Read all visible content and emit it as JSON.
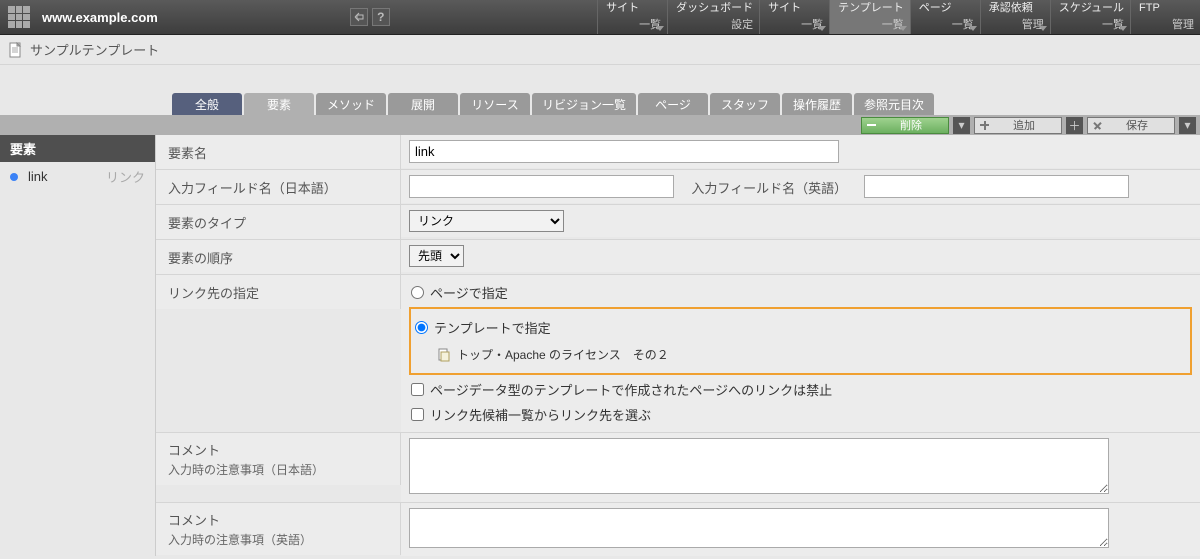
{
  "header": {
    "domain": "www.example.com"
  },
  "nav": {
    "site_list": {
      "title": "サイト",
      "sub": "一覧"
    },
    "dashboard": {
      "title": "ダッシュボード",
      "sub": "設定"
    },
    "site_admin": {
      "title": "サイト",
      "sub": "一覧"
    },
    "template": {
      "title": "テンプレート",
      "sub": "一覧"
    },
    "page": {
      "title": "ページ",
      "sub": "一覧"
    },
    "approval": {
      "title": "承認依頼",
      "sub": "管理"
    },
    "schedule": {
      "title": "スケジュール",
      "sub": "一覧"
    },
    "ftp": {
      "title": "FTP",
      "sub": "管理"
    }
  },
  "breadcrumb": {
    "title": "サンプルテンプレート"
  },
  "tabs": {
    "general": "全般",
    "element": "要素",
    "method": "メソッド",
    "expand": "展開",
    "resource": "リソース",
    "revision": "リビジョン一覧",
    "page": "ページ",
    "staff": "スタッフ",
    "history": "操作履歴",
    "ref_toc": "参照元目次"
  },
  "actions": {
    "delete": "削除",
    "add": "追加",
    "save": "保存"
  },
  "sidebar": {
    "title": "要素",
    "items": [
      {
        "name": "link",
        "type": "リンク"
      }
    ]
  },
  "form": {
    "labels": {
      "name": "要素名",
      "field_jp": "入力フィールド名（日本語）",
      "field_en": "入力フィールド名（英語）",
      "type": "要素のタイプ",
      "order": "要素の順序",
      "link_target": "リンク先の指定",
      "comment_jp_head": "コメント",
      "comment_jp_sub": "入力時の注意事項（日本語）",
      "comment_en_head": "コメント",
      "comment_en_sub": "入力時の注意事項（英語）"
    },
    "values": {
      "name": "link",
      "field_jp": "",
      "field_en": "",
      "type": "リンク",
      "order": "先頭",
      "radio_page": "ページで指定",
      "radio_template": "テンプレートで指定",
      "template_linked": "トップ・Apache のライセンス　その２",
      "cb_deny_pagedata": "ページデータ型のテンプレートで作成されたページへのリンクは禁止",
      "cb_from_candidates": "リンク先候補一覧からリンク先を選ぶ",
      "comment_jp": "",
      "comment_en": ""
    }
  }
}
